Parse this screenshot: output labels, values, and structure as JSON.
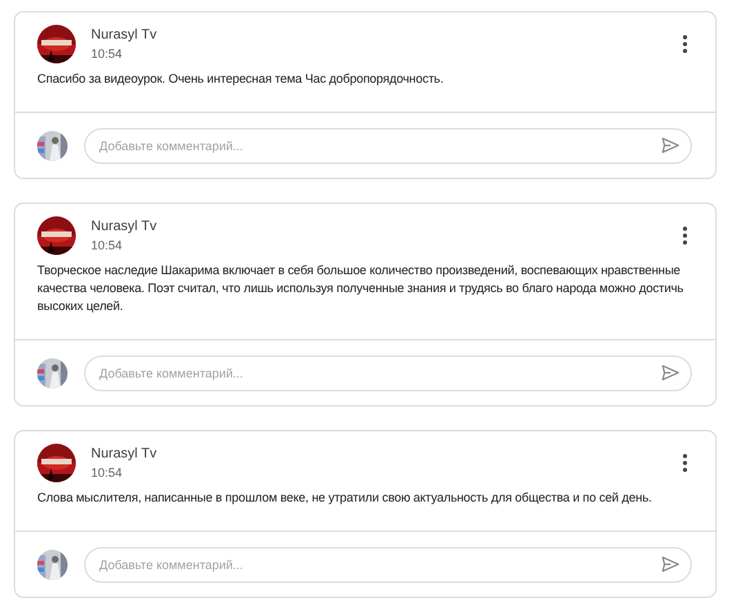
{
  "posts": [
    {
      "author": "Nurasyl Tv",
      "time": "10:54",
      "text": "Спасибо за видеоурок. Очень интересная тема Час добропорядочность.",
      "comment_placeholder": "Добавьте комментарий..."
    },
    {
      "author": "Nurasyl Tv",
      "time": "10:54",
      "text": "Творческое наследие Шакарима включает в себя большое количество произведений, воспевающих нравственные качества человека. Поэт считал, что лишь используя полученные знания и трудясь во благо народа можно достичь высоких целей.",
      "comment_placeholder": "Добавьте комментарий..."
    },
    {
      "author": "Nurasyl Tv",
      "time": "10:54",
      "text": "Слова мыслителя, написанные в прошлом веке, не утратили свою актуальность для общества и по сей день.",
      "comment_placeholder": "Добавьте комментарий..."
    }
  ]
}
